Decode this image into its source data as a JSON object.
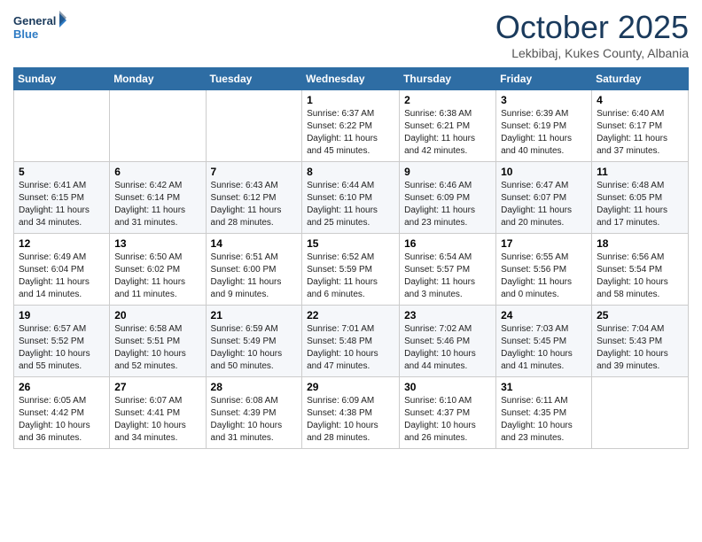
{
  "header": {
    "logo_general": "General",
    "logo_blue": "Blue",
    "month": "October 2025",
    "location": "Lekbibaj, Kukes County, Albania"
  },
  "days_of_week": [
    "Sunday",
    "Monday",
    "Tuesday",
    "Wednesday",
    "Thursday",
    "Friday",
    "Saturday"
  ],
  "weeks": [
    [
      {
        "day": "",
        "info": ""
      },
      {
        "day": "",
        "info": ""
      },
      {
        "day": "",
        "info": ""
      },
      {
        "day": "1",
        "info": "Sunrise: 6:37 AM\nSunset: 6:22 PM\nDaylight: 11 hours and 45 minutes."
      },
      {
        "day": "2",
        "info": "Sunrise: 6:38 AM\nSunset: 6:21 PM\nDaylight: 11 hours and 42 minutes."
      },
      {
        "day": "3",
        "info": "Sunrise: 6:39 AM\nSunset: 6:19 PM\nDaylight: 11 hours and 40 minutes."
      },
      {
        "day": "4",
        "info": "Sunrise: 6:40 AM\nSunset: 6:17 PM\nDaylight: 11 hours and 37 minutes."
      }
    ],
    [
      {
        "day": "5",
        "info": "Sunrise: 6:41 AM\nSunset: 6:15 PM\nDaylight: 11 hours and 34 minutes."
      },
      {
        "day": "6",
        "info": "Sunrise: 6:42 AM\nSunset: 6:14 PM\nDaylight: 11 hours and 31 minutes."
      },
      {
        "day": "7",
        "info": "Sunrise: 6:43 AM\nSunset: 6:12 PM\nDaylight: 11 hours and 28 minutes."
      },
      {
        "day": "8",
        "info": "Sunrise: 6:44 AM\nSunset: 6:10 PM\nDaylight: 11 hours and 25 minutes."
      },
      {
        "day": "9",
        "info": "Sunrise: 6:46 AM\nSunset: 6:09 PM\nDaylight: 11 hours and 23 minutes."
      },
      {
        "day": "10",
        "info": "Sunrise: 6:47 AM\nSunset: 6:07 PM\nDaylight: 11 hours and 20 minutes."
      },
      {
        "day": "11",
        "info": "Sunrise: 6:48 AM\nSunset: 6:05 PM\nDaylight: 11 hours and 17 minutes."
      }
    ],
    [
      {
        "day": "12",
        "info": "Sunrise: 6:49 AM\nSunset: 6:04 PM\nDaylight: 11 hours and 14 minutes."
      },
      {
        "day": "13",
        "info": "Sunrise: 6:50 AM\nSunset: 6:02 PM\nDaylight: 11 hours and 11 minutes."
      },
      {
        "day": "14",
        "info": "Sunrise: 6:51 AM\nSunset: 6:00 PM\nDaylight: 11 hours and 9 minutes."
      },
      {
        "day": "15",
        "info": "Sunrise: 6:52 AM\nSunset: 5:59 PM\nDaylight: 11 hours and 6 minutes."
      },
      {
        "day": "16",
        "info": "Sunrise: 6:54 AM\nSunset: 5:57 PM\nDaylight: 11 hours and 3 minutes."
      },
      {
        "day": "17",
        "info": "Sunrise: 6:55 AM\nSunset: 5:56 PM\nDaylight: 11 hours and 0 minutes."
      },
      {
        "day": "18",
        "info": "Sunrise: 6:56 AM\nSunset: 5:54 PM\nDaylight: 10 hours and 58 minutes."
      }
    ],
    [
      {
        "day": "19",
        "info": "Sunrise: 6:57 AM\nSunset: 5:52 PM\nDaylight: 10 hours and 55 minutes."
      },
      {
        "day": "20",
        "info": "Sunrise: 6:58 AM\nSunset: 5:51 PM\nDaylight: 10 hours and 52 minutes."
      },
      {
        "day": "21",
        "info": "Sunrise: 6:59 AM\nSunset: 5:49 PM\nDaylight: 10 hours and 50 minutes."
      },
      {
        "day": "22",
        "info": "Sunrise: 7:01 AM\nSunset: 5:48 PM\nDaylight: 10 hours and 47 minutes."
      },
      {
        "day": "23",
        "info": "Sunrise: 7:02 AM\nSunset: 5:46 PM\nDaylight: 10 hours and 44 minutes."
      },
      {
        "day": "24",
        "info": "Sunrise: 7:03 AM\nSunset: 5:45 PM\nDaylight: 10 hours and 41 minutes."
      },
      {
        "day": "25",
        "info": "Sunrise: 7:04 AM\nSunset: 5:43 PM\nDaylight: 10 hours and 39 minutes."
      }
    ],
    [
      {
        "day": "26",
        "info": "Sunrise: 6:05 AM\nSunset: 4:42 PM\nDaylight: 10 hours and 36 minutes."
      },
      {
        "day": "27",
        "info": "Sunrise: 6:07 AM\nSunset: 4:41 PM\nDaylight: 10 hours and 34 minutes."
      },
      {
        "day": "28",
        "info": "Sunrise: 6:08 AM\nSunset: 4:39 PM\nDaylight: 10 hours and 31 minutes."
      },
      {
        "day": "29",
        "info": "Sunrise: 6:09 AM\nSunset: 4:38 PM\nDaylight: 10 hours and 28 minutes."
      },
      {
        "day": "30",
        "info": "Sunrise: 6:10 AM\nSunset: 4:37 PM\nDaylight: 10 hours and 26 minutes."
      },
      {
        "day": "31",
        "info": "Sunrise: 6:11 AM\nSunset: 4:35 PM\nDaylight: 10 hours and 23 minutes."
      },
      {
        "day": "",
        "info": ""
      }
    ]
  ]
}
